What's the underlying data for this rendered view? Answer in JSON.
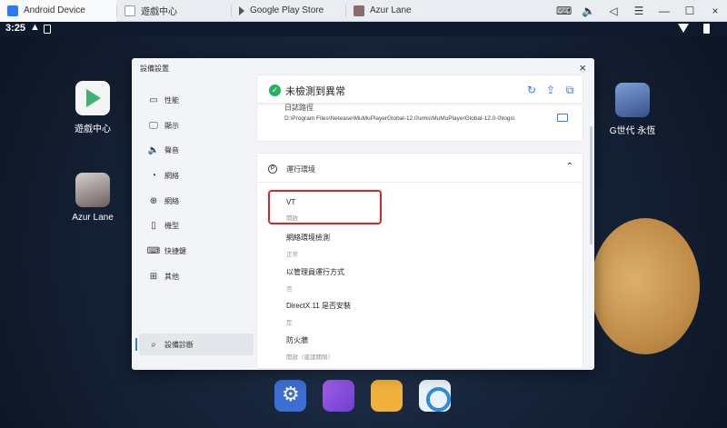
{
  "tabs": [
    {
      "label": "Android Device",
      "active": true,
      "icon": "mumu-app-icon"
    },
    {
      "label": "遊戲中心",
      "active": false,
      "icon": "window-icon"
    },
    {
      "label": "Google Play Store",
      "active": false,
      "icon": "play-store-icon"
    },
    {
      "label": "Azur Lane",
      "active": false,
      "icon": "game-icon"
    }
  ],
  "close_glyph": "×",
  "status_bar": {
    "time": "3:25"
  },
  "desktop_apps": [
    {
      "label": "遊戲中心",
      "icon": "play-store-icon"
    },
    {
      "label": "Azur Lane",
      "icon": "azur-lane-icon"
    },
    {
      "label": "G世代 永恆",
      "icon": "gundam-icon"
    }
  ],
  "dock": [
    "settings-icon",
    "gallery-icon",
    "files-icon",
    "browser-icon"
  ],
  "dialog": {
    "title": "設備設置",
    "sidebar": [
      {
        "label": "性能",
        "icon": "monitor-icon"
      },
      {
        "label": "顯示",
        "icon": "display-icon"
      },
      {
        "label": "聲音",
        "icon": "speaker-icon"
      },
      {
        "label": "網絡",
        "icon": "globe-icon"
      },
      {
        "label": "機型",
        "icon": "phone-icon"
      },
      {
        "label": "快捷鍵",
        "icon": "keyboard-icon"
      },
      {
        "label": "其他",
        "icon": "grid-icon"
      },
      {
        "label": "設備診斷",
        "icon": "diagnosis-icon",
        "active": true
      }
    ],
    "status_text": "未檢測到異常",
    "log": {
      "label": "日誌路徑",
      "path": "D:\\Program Files\\Netease\\MuMuPlayerGlobal-12.0\\vms\\MuMuPlayerGlobal-12.0-0\\logs\\"
    },
    "env": {
      "title": "運行環境",
      "items": [
        {
          "name": "VT",
          "value": "開啟"
        },
        {
          "name": "網絡環境檢測",
          "value": "正常"
        },
        {
          "name": "以管理員運行方式",
          "value": "否"
        },
        {
          "name": "DirectX 11 是否安裝",
          "value": "是"
        },
        {
          "name": "防火牆",
          "value": "開啟（建議關閉）"
        }
      ]
    }
  },
  "colors": {
    "accent": "#2a79ff",
    "ok": "#23b15a",
    "highlight": "#d9262d"
  }
}
